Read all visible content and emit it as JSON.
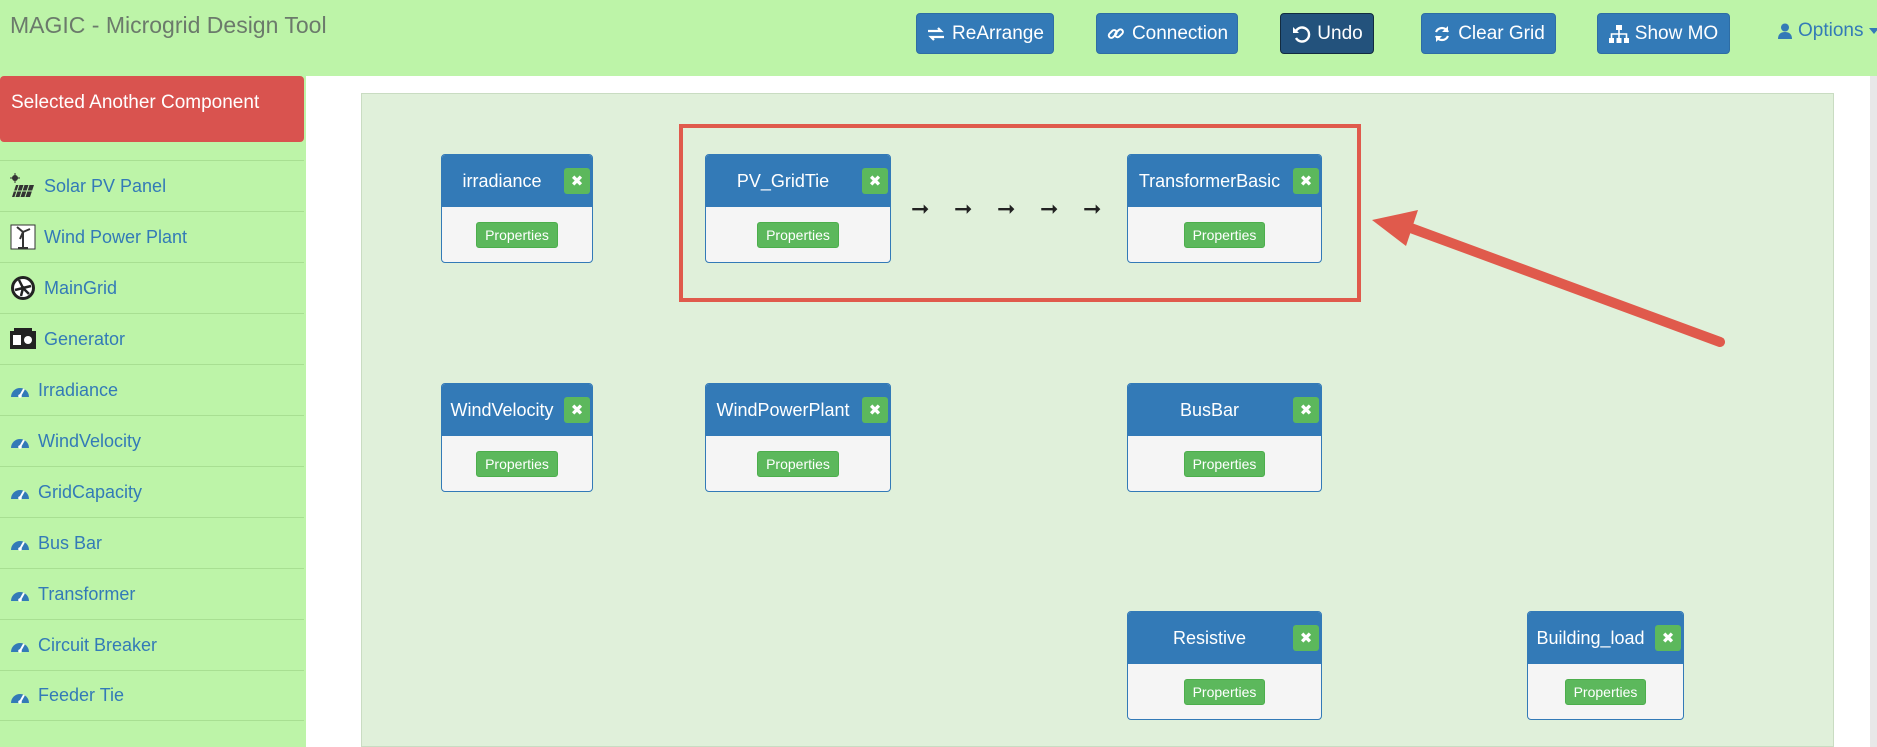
{
  "app": {
    "title": "MAGIC - Microgrid Design Tool"
  },
  "toolbar": {
    "buttons": [
      {
        "label": "ReArrange",
        "icon": "exchange-icon"
      },
      {
        "label": "Connection",
        "icon": "link-icon"
      },
      {
        "label": "Undo",
        "icon": "undo-icon"
      },
      {
        "label": "Clear Grid",
        "icon": "refresh-icon"
      },
      {
        "label": "Show MO",
        "icon": "sitemap-icon"
      }
    ],
    "options_label": "Options"
  },
  "sidebar": {
    "alert": "Selected Another Component",
    "items": [
      {
        "label": "Solar PV Panel",
        "icon": "solar-panel-icon"
      },
      {
        "label": "Wind Power Plant",
        "icon": "wind-turbine-icon"
      },
      {
        "label": "MainGrid",
        "icon": "grid-fan-icon"
      },
      {
        "label": "Generator",
        "icon": "generator-icon"
      },
      {
        "label": "Irradiance",
        "icon": "gauge-icon"
      },
      {
        "label": "WindVelocity",
        "icon": "gauge-icon"
      },
      {
        "label": "GridCapacity",
        "icon": "gauge-icon"
      },
      {
        "label": "Bus Bar",
        "icon": "gauge-icon"
      },
      {
        "label": "Transformer",
        "icon": "gauge-icon"
      },
      {
        "label": "Circuit Breaker",
        "icon": "gauge-icon"
      },
      {
        "label": "Feeder Tie",
        "icon": "gauge-icon"
      }
    ]
  },
  "canvas": {
    "properties_label": "Properties",
    "close_glyph": "✖",
    "arrow_glyph": "➞",
    "nodes": [
      {
        "title": "irradiance"
      },
      {
        "title": "PV_GridTie"
      },
      {
        "title": "TransformerBasic"
      },
      {
        "title": "WindVelocity"
      },
      {
        "title": "WindPowerPlant"
      },
      {
        "title": "BusBar"
      },
      {
        "title": "Resistive"
      },
      {
        "title": "Building_load"
      }
    ]
  },
  "colors": {
    "background": "#bdf4a8",
    "primary": "#337ab7",
    "success": "#5cb85c",
    "danger": "#d9534f",
    "annotation": "#e05a4c"
  }
}
